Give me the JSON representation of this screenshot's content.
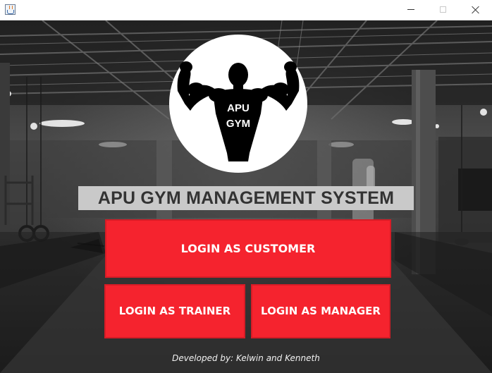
{
  "window": {
    "controls": {
      "minimize_icon": "minimize-icon",
      "maximize_icon": "maximize-icon",
      "close_icon": "close-icon"
    }
  },
  "logo": {
    "line1": "APU",
    "line2": "GYM"
  },
  "title": "APU GYM MANAGEMENT SYSTEM",
  "buttons": {
    "customer": "LOGIN AS CUSTOMER",
    "trainer": "LOGIN AS TRAINER",
    "manager": "LOGIN AS MANAGER"
  },
  "credit": "Developed by: Kelwin and Kenneth",
  "colors": {
    "button_red": "#f5232e",
    "title_bar": "#c9c9c9",
    "title_text": "#333333",
    "logo_bg": "#ffffff",
    "logo_silhouette": "#000000"
  }
}
